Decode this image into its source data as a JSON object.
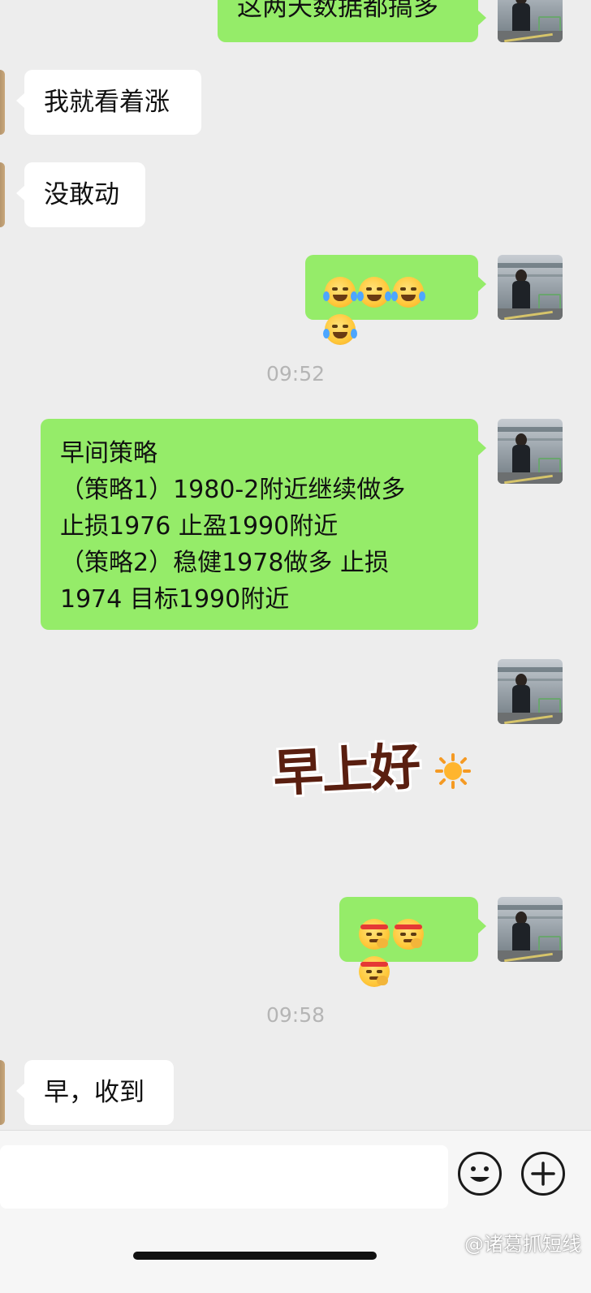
{
  "messages": [
    {
      "id": "m1",
      "side": "right",
      "text": "这两天数据都搞多"
    },
    {
      "id": "m2",
      "side": "left",
      "text": "我就看着涨"
    },
    {
      "id": "m3",
      "side": "left",
      "text": "没敢动"
    },
    {
      "id": "m4",
      "side": "right",
      "emoji": "crying-laughing-emoji",
      "count": 4
    },
    {
      "id": "m6",
      "side": "right",
      "lines": [
        "早间策略",
        "（策略1）1980-2附近继续做多",
        "止损1976  止盈1990附近",
        "（策略2）稳健1978做多  止损",
        "1974  目标1990附近"
      ]
    },
    {
      "id": "m7",
      "side": "right",
      "sticker_text": "早上好",
      "sticker_icon": "sun-icon"
    },
    {
      "id": "m8",
      "side": "right",
      "emoji": "shush-emoji",
      "count": 3
    },
    {
      "id": "m10",
      "side": "left",
      "text": "早，收到"
    }
  ],
  "timestamps": {
    "t1": "09:52",
    "t2": "09:58"
  },
  "input_bar": {
    "emoji_button": "smiley-icon",
    "plus_button": "plus-icon"
  },
  "watermark": "@诸葛抓短线",
  "colors": {
    "bubble_mine": "#95ec69",
    "bubble_other": "#ffffff",
    "background": "#ededed"
  }
}
